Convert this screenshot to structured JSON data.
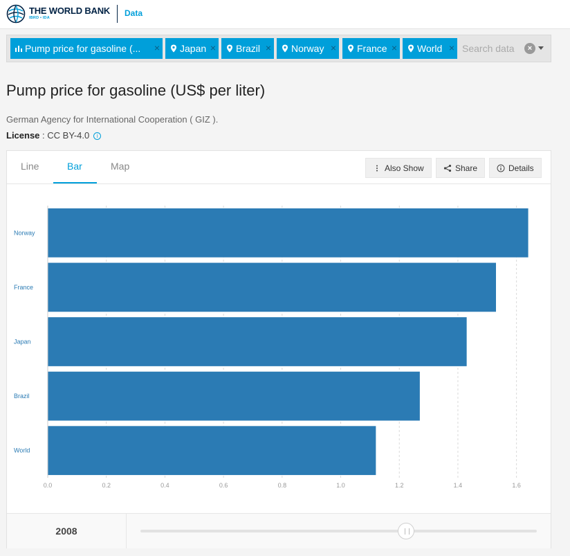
{
  "header": {
    "brand_name": "THE WORLD BANK",
    "brand_sub": "IBRD • IDA",
    "section_link": "Data"
  },
  "filters": {
    "chips": [
      {
        "label": "Pump price for gasoline (...",
        "icon": "bar-chart-icon"
      },
      {
        "label": "Japan",
        "icon": "location-pin-icon"
      },
      {
        "label": "Brazil",
        "icon": "location-pin-icon"
      },
      {
        "label": "Norway",
        "icon": "location-pin-icon"
      },
      {
        "label": "France",
        "icon": "location-pin-icon"
      },
      {
        "label": "World",
        "icon": "location-pin-icon"
      }
    ],
    "remove_glyph": "×",
    "search_placeholder": "Search data",
    "clear_glyph": "×"
  },
  "page": {
    "title": "Pump price for gasoline (US$ per liter)",
    "source": "German Agency for International Cooperation ( GIZ ).",
    "license_label": "License",
    "license_value": " : CC BY-4.0"
  },
  "tabs": {
    "line": "Line",
    "bar": "Bar",
    "map": "Map",
    "active": "bar"
  },
  "toolbar": {
    "also_show": "Also Show",
    "share": "Share",
    "details": "Details"
  },
  "colors": {
    "accent": "#009fda",
    "bar": "#2b7bb4",
    "brand_navy": "#002244"
  },
  "time": {
    "year": "2008",
    "slider_fraction": 0.67
  },
  "chart_data": {
    "type": "bar",
    "orientation": "horizontal",
    "categories": [
      "Norway",
      "France",
      "Japan",
      "Brazil",
      "World"
    ],
    "values": [
      1.64,
      1.53,
      1.43,
      1.27,
      1.12
    ],
    "xlim": [
      0,
      1.7
    ],
    "xticks": [
      0.0,
      0.2,
      0.4,
      0.6,
      0.8,
      1.0,
      1.2,
      1.4,
      1.6
    ],
    "xtick_labels": [
      "0.0",
      "0.2",
      "0.4",
      "0.6",
      "0.8",
      "1.0",
      "1.2",
      "1.4",
      "1.6"
    ],
    "grid": "vertical-dashed",
    "title": "",
    "xlabel": "",
    "ylabel": ""
  }
}
